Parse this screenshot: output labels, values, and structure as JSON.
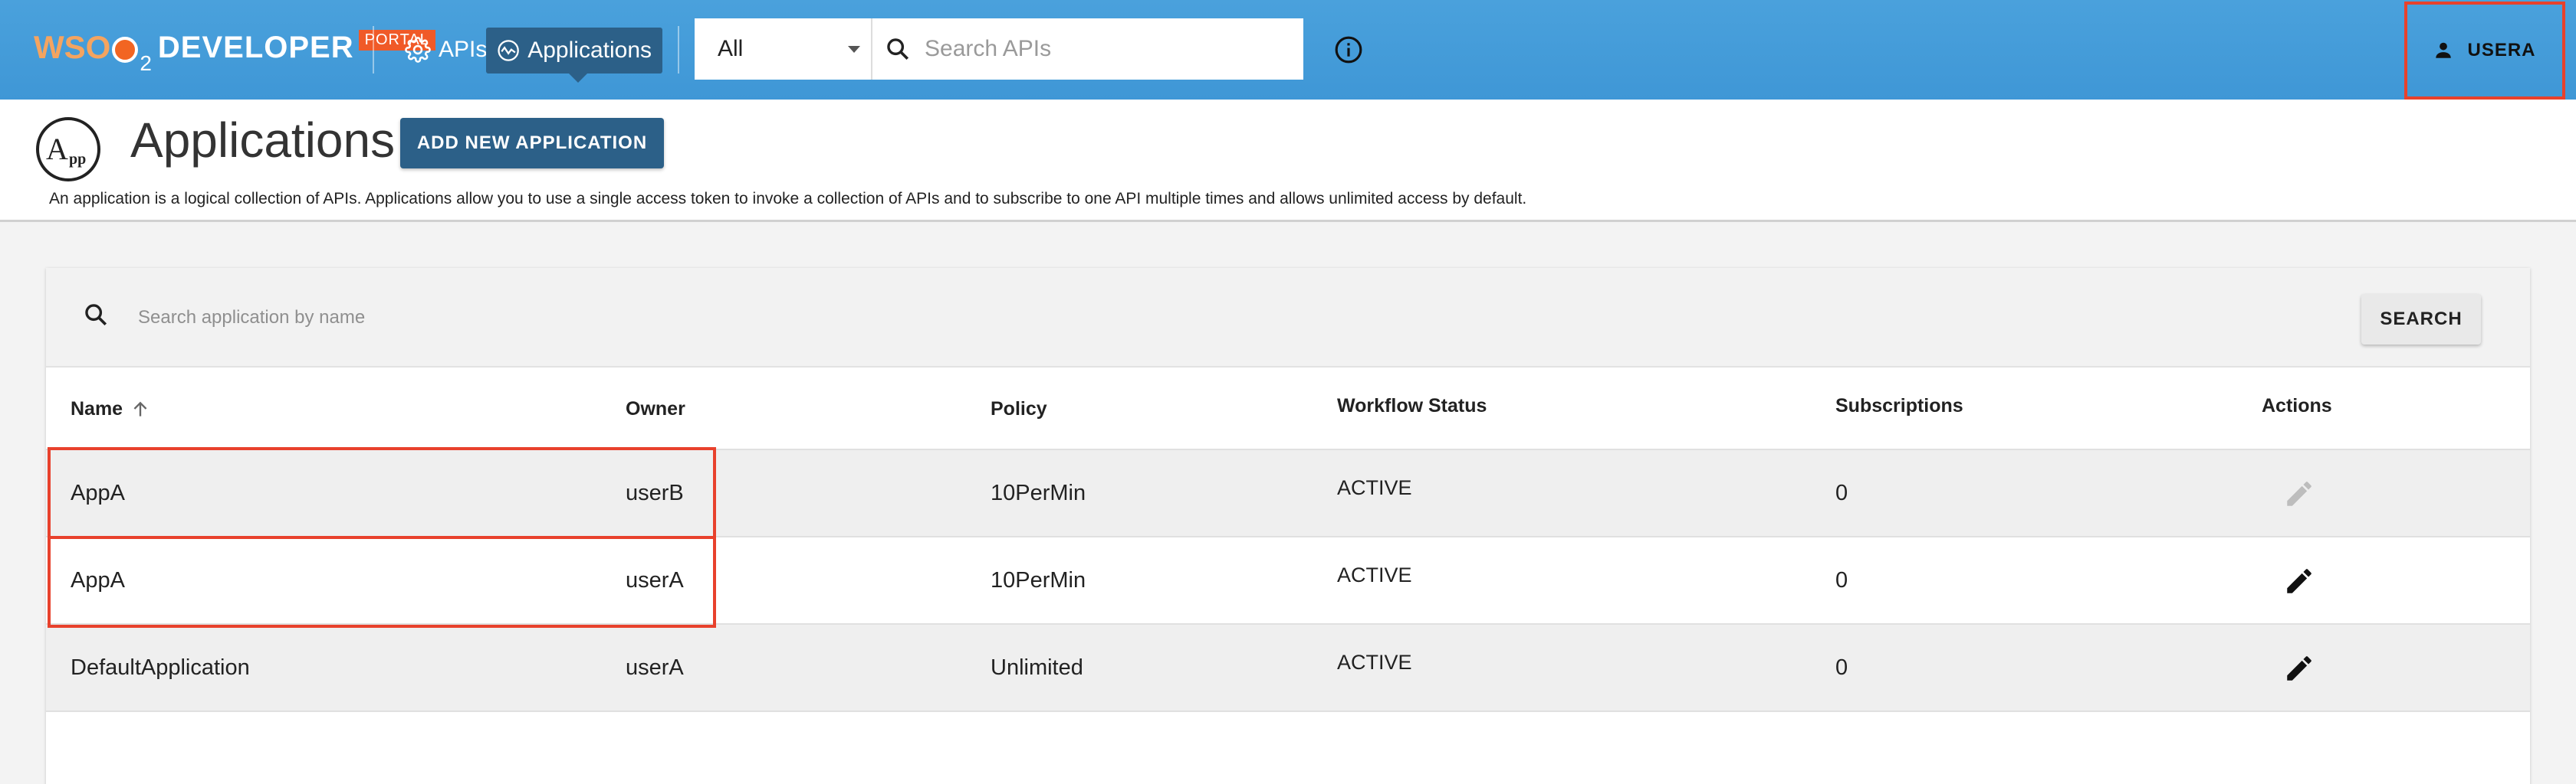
{
  "topbar": {
    "logo": {
      "brand": "WSO",
      "sub": "2",
      "product": "DEVELOPER",
      "tag": "PORTAL"
    },
    "nav": [
      {
        "label": "APIs",
        "icon": "gear-icon"
      },
      {
        "label": "Applications",
        "icon": "applications-icon",
        "active": true
      }
    ],
    "scope_select": {
      "value": "All"
    },
    "search": {
      "placeholder": "Search APIs"
    },
    "user": {
      "label": "USERA",
      "icon": "person-icon"
    }
  },
  "header": {
    "logo_text": "App",
    "title": "Applications",
    "add_button": "ADD NEW APPLICATION",
    "description": "An application is a logical collection of APIs. Applications allow you to use a single access token to invoke a collection of APIs and to subscribe to one API multiple times and allows unlimited access by default."
  },
  "app_search": {
    "placeholder": "Search application by name",
    "button": "SEARCH"
  },
  "table": {
    "columns": [
      "Name",
      "Owner",
      "Policy",
      "Workflow Status",
      "Subscriptions",
      "Actions"
    ],
    "sort_icon": "arrow-up-icon",
    "rows": [
      {
        "name": "AppA",
        "owner": "userB",
        "policy": "10PerMin",
        "status": "ACTIVE",
        "subscriptions": "0",
        "editable": false
      },
      {
        "name": "AppA",
        "owner": "userA",
        "policy": "10PerMin",
        "status": "ACTIVE",
        "subscriptions": "0",
        "editable": true
      },
      {
        "name": "DefaultApplication",
        "owner": "userA",
        "policy": "Unlimited",
        "status": "ACTIVE",
        "subscriptions": "0",
        "editable": true
      }
    ]
  },
  "colors": {
    "topbar": "#4aa1dc",
    "primary_button": "#2c6088",
    "highlight": "#e8412c",
    "portal_tag": "#f05a28"
  }
}
